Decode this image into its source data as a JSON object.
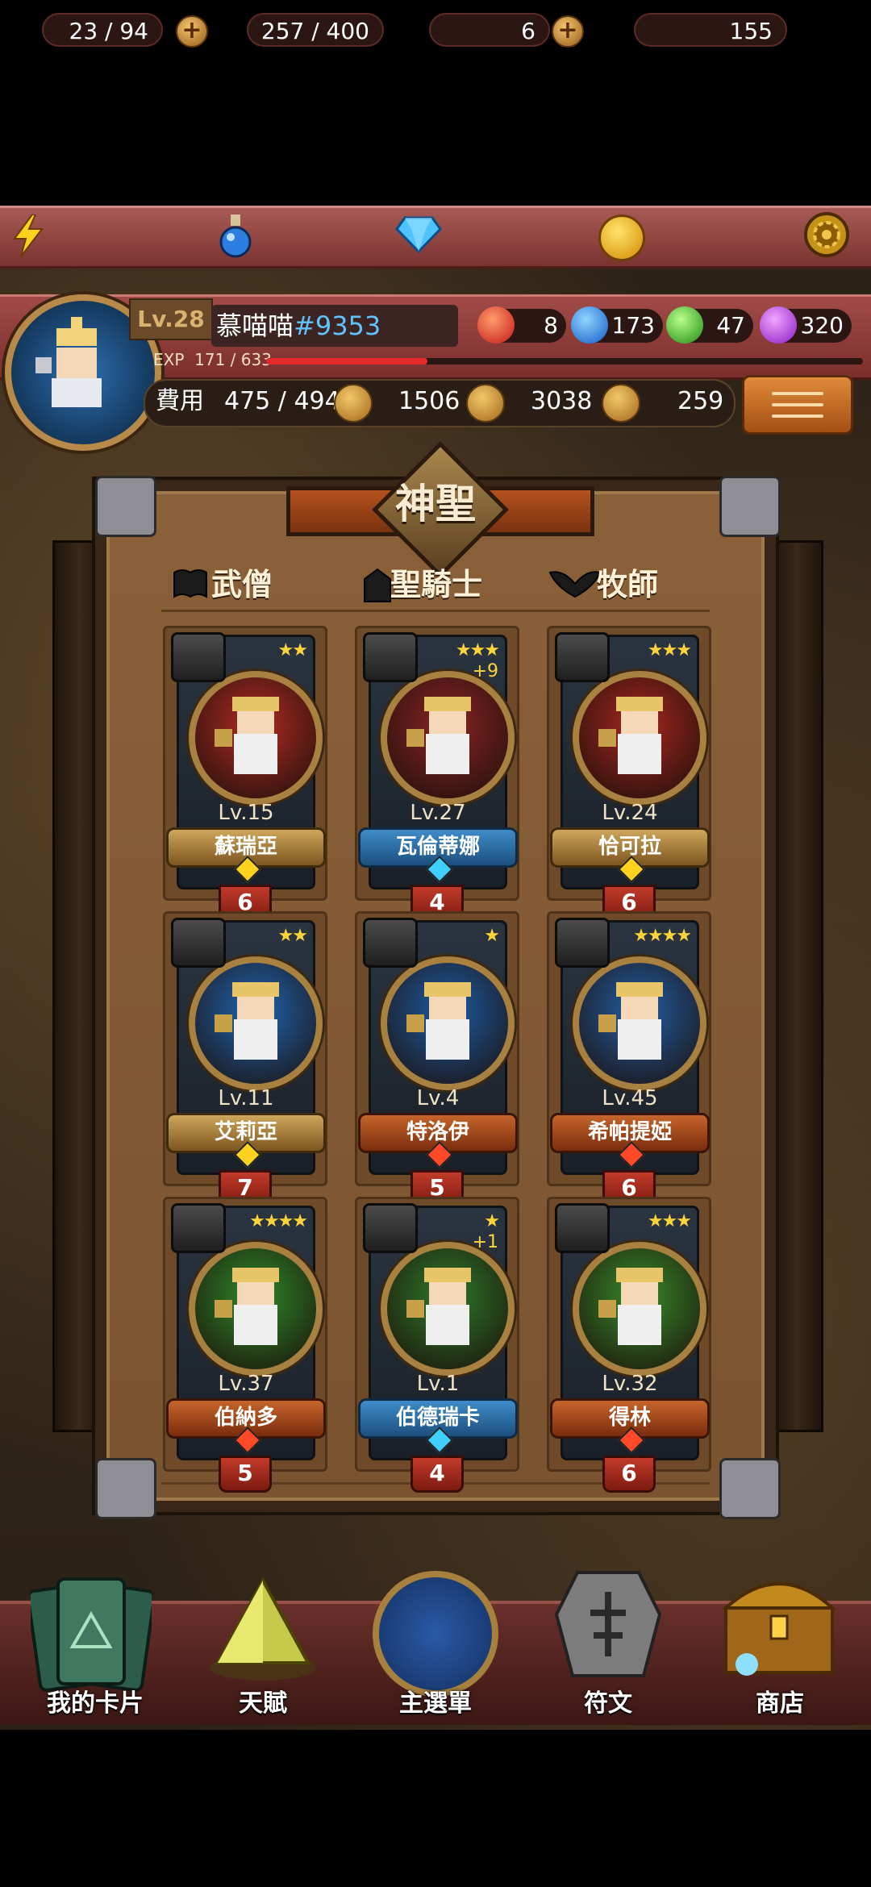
{
  "resources": {
    "energy": "23 / 94",
    "potion": "257 / 400",
    "diamonds": "6",
    "gold": "155"
  },
  "profile": {
    "level": "Lv.28",
    "name": "慕喵喵",
    "tag": "#9353",
    "exp_label": "EXP",
    "exp_value": "171 / 633",
    "exp_fraction": 0.27,
    "gems": {
      "red": "8",
      "blue": "173",
      "green": "47",
      "purple": "320"
    }
  },
  "stats": {
    "cost_label": "費用",
    "cost_value": "475 / 494",
    "attack": "1506",
    "heart": "3038",
    "plus": "259"
  },
  "panel": {
    "title": "神聖",
    "columns": [
      {
        "label": "武僧",
        "icon": "book-icon"
      },
      {
        "label": "聖騎士",
        "icon": "helmet-icon"
      },
      {
        "label": "牧師",
        "icon": "wings-icon"
      }
    ],
    "cards": [
      {
        "name": "蘇瑞亞",
        "level": "Lv.15",
        "stars": "★★",
        "cost": "6",
        "plus": "",
        "style": "gold",
        "bg": "#b22b23"
      },
      {
        "name": "瓦倫蒂娜",
        "level": "Lv.27",
        "stars": "★★★",
        "cost": "4",
        "plus": "+9",
        "style": "blue",
        "bg": "#8b2424"
      },
      {
        "name": "恰可拉",
        "level": "Lv.24",
        "stars": "★★★",
        "cost": "6",
        "plus": "",
        "style": "gold",
        "bg": "#a7261f"
      },
      {
        "name": "艾莉亞",
        "level": "Lv.11",
        "stars": "★★",
        "cost": "7",
        "plus": "",
        "style": "gold",
        "bg": "#1f66b4"
      },
      {
        "name": "特洛伊",
        "level": "Lv.4",
        "stars": "★",
        "cost": "5",
        "plus": "",
        "style": "red",
        "bg": "#1d5da6"
      },
      {
        "name": "希帕提婭",
        "level": "Lv.45",
        "stars": "★★★★",
        "cost": "6",
        "plus": "",
        "style": "red",
        "bg": "#215fa5"
      },
      {
        "name": "伯納多",
        "level": "Lv.37",
        "stars": "★★★★",
        "cost": "5",
        "plus": "",
        "style": "red",
        "bg": "#2f8a2b"
      },
      {
        "name": "伯德瑞卡",
        "level": "Lv.1",
        "stars": "★",
        "cost": "4",
        "plus": "+1",
        "style": "blue",
        "bg": "#2f7a2b"
      },
      {
        "name": "得林",
        "level": "Lv.32",
        "stars": "★★★",
        "cost": "6",
        "plus": "",
        "style": "red",
        "bg": "#388c2c"
      }
    ]
  },
  "nav": {
    "cards": "我的卡片",
    "talent": "天賦",
    "main": "主選單",
    "rune": "符文",
    "shop": "商店"
  }
}
